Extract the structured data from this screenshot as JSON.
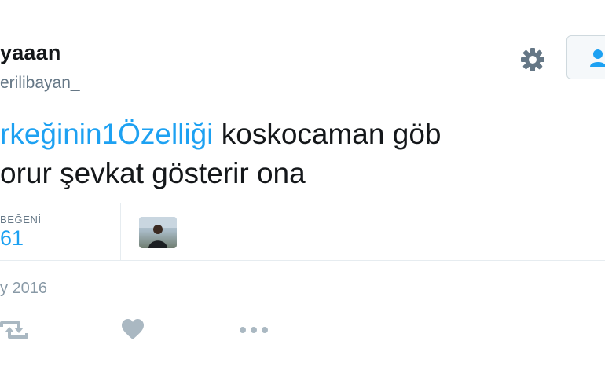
{
  "user": {
    "name": "yaaan",
    "handle": "erilibayan_"
  },
  "tweet": {
    "hashtag": "rkeğinin1Özelliği",
    "line1_rest": " koskocaman göb",
    "line2": "orur şevkat gösterir ona"
  },
  "stats": {
    "likes_label": "BEĞENİ",
    "likes_count": "61"
  },
  "meta": {
    "date": "y 2016"
  },
  "colors": {
    "accent": "#1da1f2",
    "secondary_text": "#657786",
    "action_icon": "#aab8c2"
  },
  "icons": {
    "settings": "gear-icon",
    "follow": "follow-user-icon",
    "retweet": "retweet-icon",
    "like": "heart-icon",
    "more": "more-dots-icon"
  }
}
